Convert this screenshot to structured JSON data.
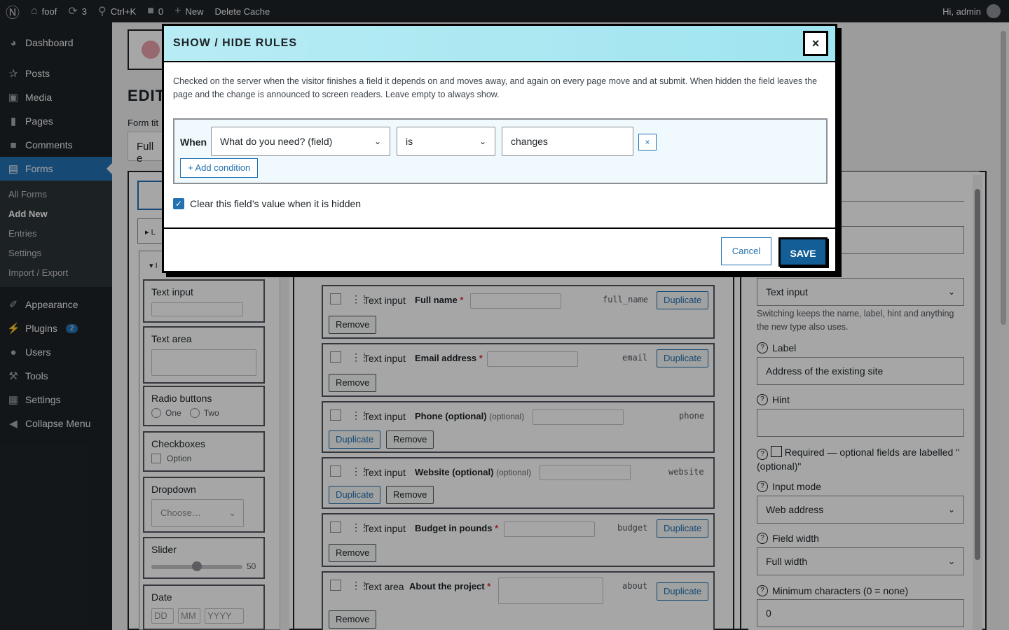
{
  "adminbar": {
    "site": "foof",
    "updates": "3",
    "search": "Ctrl+K",
    "comments": "0",
    "new": "New",
    "delete_cache": "Delete Cache",
    "greeting": "Hi, admin"
  },
  "menu": {
    "dashboard": "Dashboard",
    "posts": "Posts",
    "media": "Media",
    "pages": "Pages",
    "comments": "Comments",
    "forms": "Forms",
    "sub": [
      "All Forms",
      "Add New",
      "Entries",
      "Settings",
      "Import / Export"
    ],
    "appearance": "Appearance",
    "plugins": "Plugins",
    "plugins_badge": "2",
    "users": "Users",
    "tools": "Tools",
    "settings": "Settings",
    "collapse": "Collapse Menu"
  },
  "page": {
    "title_frag": "EDIT",
    "form_title_label": "Form tit",
    "form_title_value": "Full e"
  },
  "palette": [
    {
      "label": "Text input"
    },
    {
      "label": "Text area"
    },
    {
      "label": "Radio buttons",
      "opts": [
        "One",
        "Two"
      ]
    },
    {
      "label": "Checkboxes",
      "opts": [
        "Option"
      ]
    },
    {
      "label": "Dropdown",
      "placeholder": "Choose…"
    },
    {
      "label": "Slider",
      "value": "50"
    },
    {
      "label": "Date",
      "parts": [
        "DD",
        "MM",
        "YYYY"
      ]
    }
  ],
  "fields": [
    {
      "type": "Text input",
      "name": "Full name",
      "required": "*",
      "key": "full_name"
    },
    {
      "type": "Text input",
      "name": "Email address",
      "required": "*",
      "key": "email"
    },
    {
      "type": "Text input",
      "name": "Phone (optional)",
      "optional": "(optional)",
      "key": "phone"
    },
    {
      "type": "Text input",
      "name": "Website (optional)",
      "optional": "(optional)",
      "key": "website"
    },
    {
      "type": "Text input",
      "name": "Budget in pounds",
      "required": "*",
      "key": "budget"
    },
    {
      "type": "Text area",
      "name": "About the project",
      "required": "*",
      "key": "about"
    }
  ],
  "buttons": {
    "duplicate": "Duplicate",
    "remove": "Remove"
  },
  "settings": {
    "type_value": "Text input",
    "type_hint": "Switching keeps the name, label, hint and anything the new type also uses.",
    "label_label": "Label",
    "label_value": "Address of the existing site",
    "hint_label": "Hint",
    "required_label": "Required — optional fields are labelled \"(optional)\"",
    "input_mode_label": "Input mode",
    "input_mode_value": "Web address",
    "width_label": "Field width",
    "width_value": "Full width",
    "min_label": "Minimum characters (0 = none)",
    "min_value": "0",
    "help": "?"
  },
  "modal": {
    "title": "SHOW / HIDE RULES",
    "close": "×",
    "description": "Checked on the server when the visitor finishes a field it depends on and moves away, and again on every page move and at submit. When hidden the field leaves the page and the change is announced to screen readers. Leave empty to always show.",
    "when": "When",
    "field_value": "What do you need? (field)",
    "op_value": "is",
    "cond_value": "changes",
    "remove_cond": "×",
    "add_condition": "+ Add condition",
    "clear_label": "Clear this field’s value when it is hidden",
    "cancel": "Cancel",
    "save": "SAVE"
  }
}
